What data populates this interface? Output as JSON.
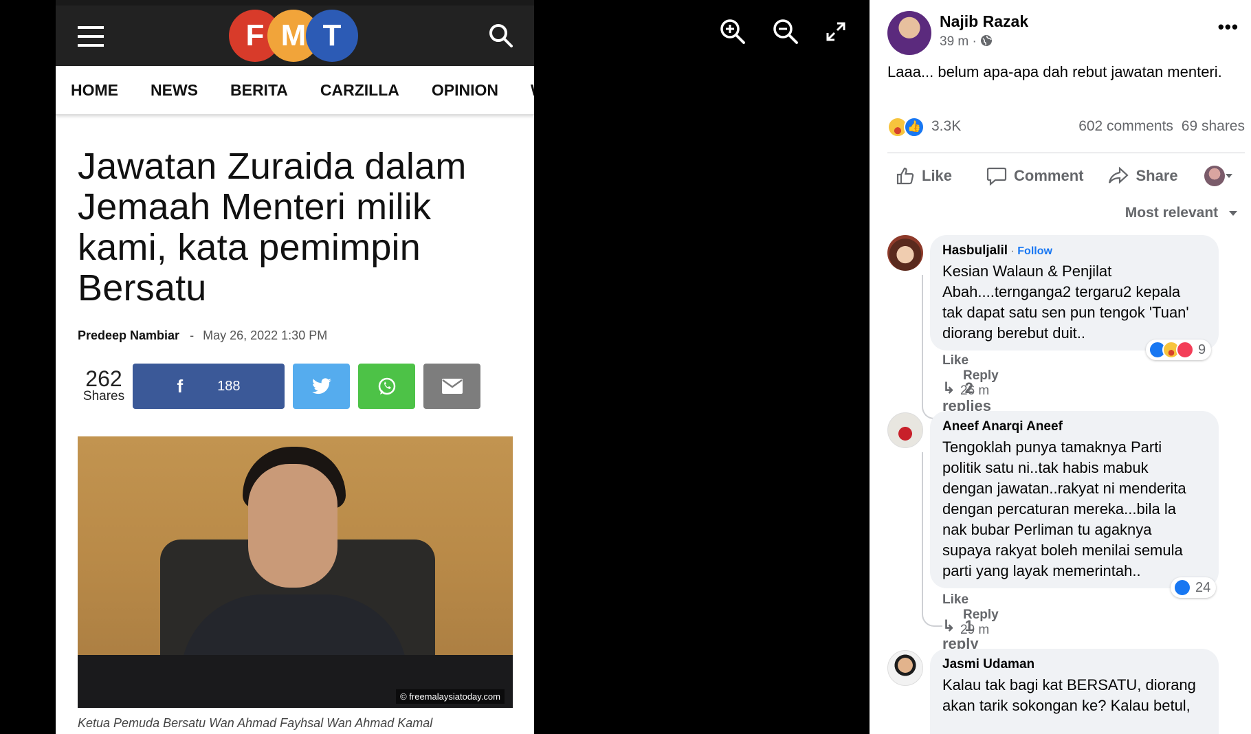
{
  "viewer": {
    "controls": [
      "zoom-in-icon",
      "zoom-out-icon",
      "fullscreen-icon"
    ]
  },
  "fmt": {
    "logo": [
      "F",
      "M",
      "T"
    ],
    "logo_colors": [
      "#d83b2a",
      "#f1a43a",
      "#2c5bb5"
    ],
    "nav": [
      "HOME",
      "NEWS",
      "BERITA",
      "CARZILLA",
      "OPINION",
      "W"
    ],
    "headline": "Jawatan Zuraida dalam Jemaah Menteri milik kami, kata pemimpin Bersatu",
    "author": "Predeep Nambiar",
    "separator": "-",
    "date": "May 26, 2022 1:30 PM",
    "share_total": "262",
    "share_label": "Shares",
    "facebook_count": "188",
    "share_colors": {
      "facebook": "#3b5998",
      "twitter": "#55acee",
      "whatsapp": "#4dc247",
      "email": "#7d7d7d"
    },
    "photo_watermark": "© freemalaysiatoday.com",
    "caption": "Ketua Pemuda Bersatu Wan Ahmad Fayhsal Wan Ahmad Kamal"
  },
  "post": {
    "author": "Najib Razak",
    "time": "39 m ·",
    "text": "Laaa... belum apa-apa dah rebut jawatan menteri.",
    "reaction_count": "3.3K",
    "comments": "602 comments",
    "shares": "69 shares",
    "actions": {
      "like": "Like",
      "comment": "Comment",
      "share": "Share"
    },
    "sort": "Most relevant"
  },
  "comments": [
    {
      "name": "Hasbuljalil",
      "follow": "Follow",
      "lines": [
        "Kesian Walaun & Penjilat",
        "Abah....ternganga2 tergaru2 kepala",
        "tak dapat satu sen pun tengok 'Tuan'",
        "diorang berebut duit.."
      ],
      "like": "Like",
      "reply": "Reply",
      "time": "26 m",
      "reactions": "9",
      "replies": "2 replies"
    },
    {
      "name": "Aneef Anarqi Aneef",
      "lines": [
        "Tengoklah punya tamaknya Parti",
        "politik satu ni..tak habis mabuk",
        "dengan jawatan..rakyat ni menderita",
        "dengan percaturan mereka...bila la",
        "nak bubar Perliman tu agaknya",
        "supaya rakyat boleh menilai semula",
        "parti yang layak memerintah.."
      ],
      "like": "Like",
      "reply": "Reply",
      "time": "29 m",
      "reactions": "24",
      "replies": "1 reply"
    },
    {
      "name": "Jasmi Udaman",
      "lines": [
        "Kalau tak bagi kat BERSATU, diorang",
        "akan tarik sokongan ke? Kalau betul,"
      ]
    }
  ]
}
